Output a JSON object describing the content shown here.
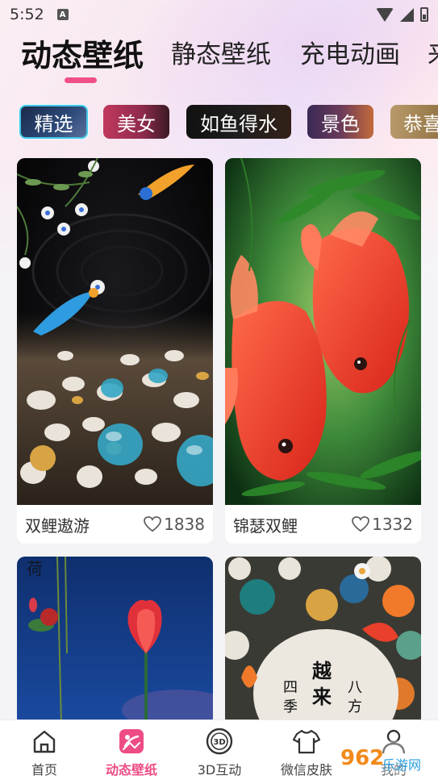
{
  "status_bar": {
    "time": "5:52",
    "notification_badge": "A"
  },
  "top_tabs": [
    {
      "label": "动态壁纸",
      "active": true
    },
    {
      "label": "静态壁纸",
      "active": false
    },
    {
      "label": "充电动画",
      "active": false
    },
    {
      "label": "来",
      "active": false
    }
  ],
  "categories": [
    {
      "label": "精选",
      "selected": true
    },
    {
      "label": "美女",
      "selected": false
    },
    {
      "label": "如鱼得水",
      "selected": false
    },
    {
      "label": "景色",
      "selected": false
    },
    {
      "label": "恭喜",
      "selected": false
    }
  ],
  "cards": [
    {
      "title": "双鲤遨游",
      "likes": "1838"
    },
    {
      "title": "锦瑟双鲤",
      "likes": "1332"
    },
    {
      "title": "",
      "likes": ""
    },
    {
      "title": "",
      "likes": ""
    }
  ],
  "card3_calligraphy": [
    "越",
    "来",
    "八",
    "方",
    "四",
    "季"
  ],
  "bottom_nav": [
    {
      "label": "首页",
      "icon": "home-icon",
      "active": false
    },
    {
      "label": "动态壁纸",
      "icon": "wallpaper-icon",
      "active": true
    },
    {
      "label": "3D互动",
      "icon": "3d-icon",
      "active": false
    },
    {
      "label": "微信皮肤",
      "icon": "shirt-icon",
      "active": false
    },
    {
      "label": "我的",
      "icon": "person-icon",
      "active": false
    }
  ],
  "icon_3d_text": "3D",
  "watermark": {
    "logo": "962",
    "text": "乐游网"
  },
  "colors": {
    "accent": "#ef4f86",
    "chip_selected_border": "#44c7e6"
  }
}
